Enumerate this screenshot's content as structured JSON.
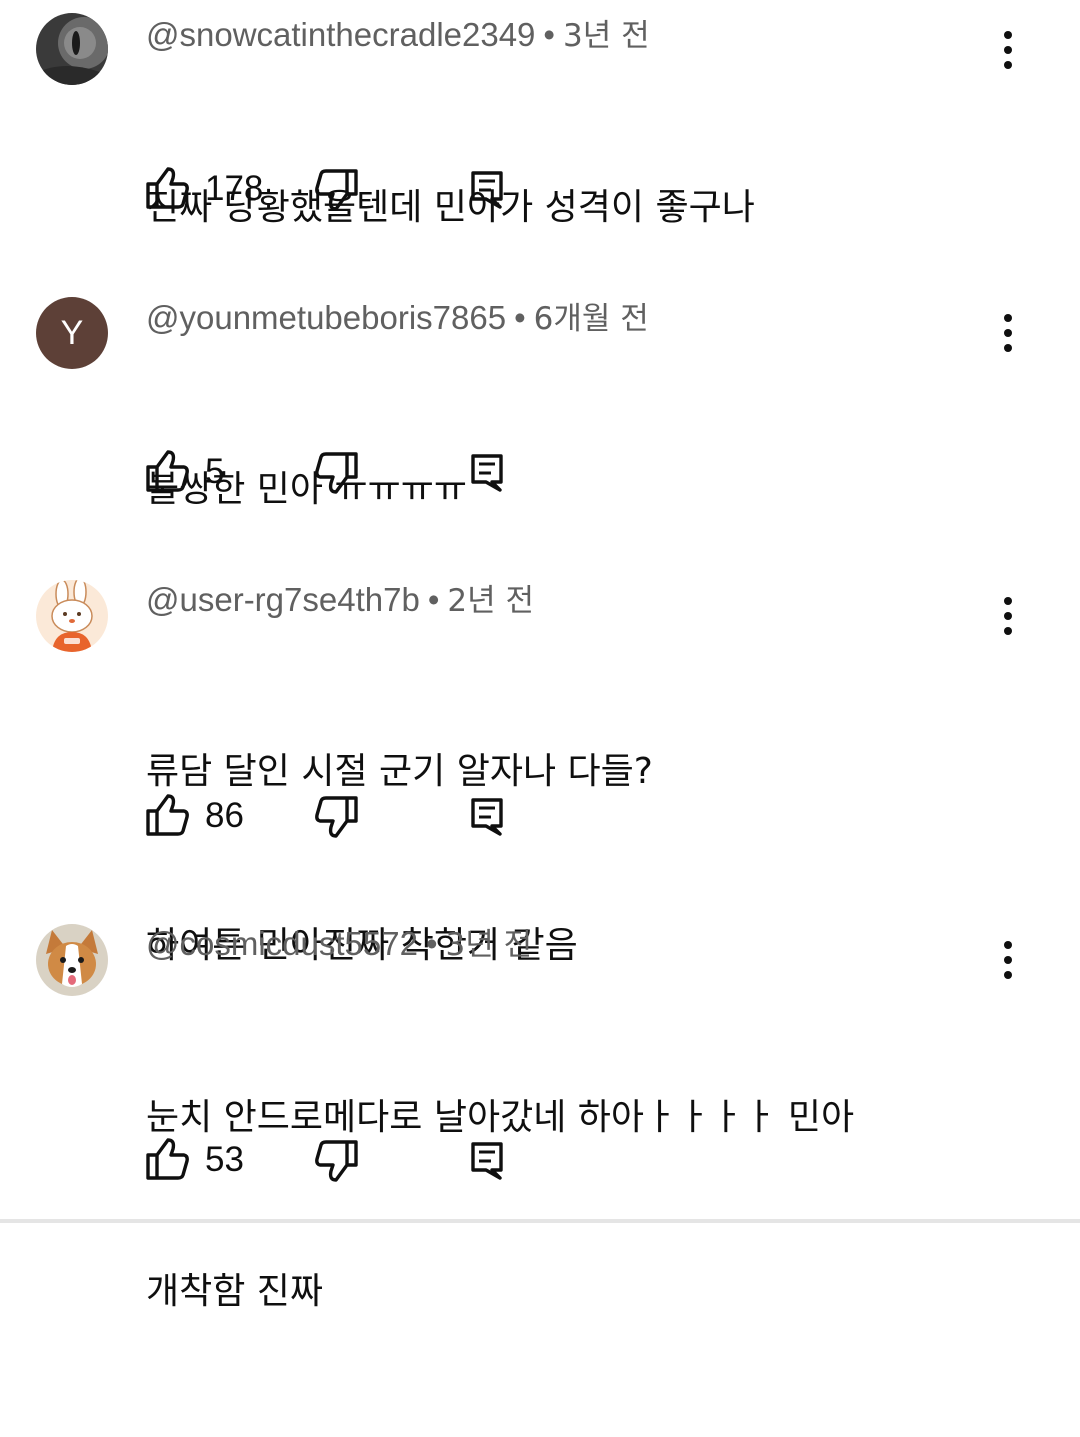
{
  "separator": "•",
  "comments": [
    {
      "author": "@snowcatinthecradle2349",
      "time": "3년 전",
      "lines": [
        "진짜 당황했을텐데 민아가 성격이 좋구나"
      ],
      "likes": "178",
      "avatar": "cat-photo"
    },
    {
      "author": "@younmetubeboris7865",
      "time": "6개월 전",
      "lines": [
        "불쌍한 민아 ㅠㅠㅠㅠ"
      ],
      "likes": "5",
      "avatar_letter": "Y",
      "avatar_color": "#5d4037"
    },
    {
      "author": "@user-rg7se4th7b",
      "time": "2년 전",
      "lines": [
        "류담 달인 시절 군기 알자나 다들?",
        "하여튼 민아진짜 착한거 같음"
      ],
      "likes": "86",
      "avatar": "rabbit-illustration"
    },
    {
      "author": "@cosmicdust5572",
      "time": "3년 전",
      "lines": [
        "눈치 안드로메다로 날아갔네 하아ㅏㅏㅏㅏ 민아",
        "개착함 진짜"
      ],
      "likes": "53",
      "avatar": "corgi-photo"
    }
  ],
  "icons": {
    "like": "thumb-up-icon",
    "dislike": "thumb-down-icon",
    "reply": "reply-icon",
    "menu": "more-vertical-icon"
  }
}
